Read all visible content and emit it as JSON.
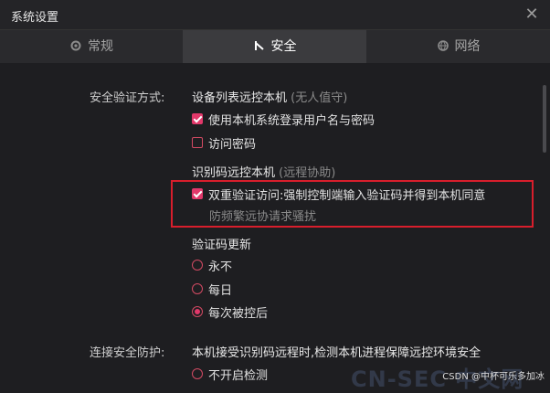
{
  "window": {
    "title": "系统设置"
  },
  "tabs": [
    {
      "label": "常规",
      "icon": "gear-icon",
      "active": false
    },
    {
      "label": "安全",
      "icon": "shield-icon",
      "active": true
    },
    {
      "label": "网络",
      "icon": "globe-icon",
      "active": false
    }
  ],
  "security": {
    "section_label": "安全验证方式:",
    "device_list": {
      "title": "设备列表远控本机",
      "note": "(无人值守)",
      "options": [
        {
          "label": "使用本机系统登录用户名与密码",
          "checked": true
        },
        {
          "label": "访问密码",
          "checked": false
        }
      ]
    },
    "id_code": {
      "title": "识别码远控本机",
      "note": "(远程协助)",
      "two_factor": {
        "label": "双重验证访问:强制控制端输入验证码并得到本机同意",
        "sub": "防频繁远协请求骚扰",
        "checked": true
      }
    },
    "code_update": {
      "title": "验证码更新",
      "options": [
        {
          "label": "永不",
          "selected": false
        },
        {
          "label": "每日",
          "selected": false
        },
        {
          "label": "每次被控后",
          "selected": true
        }
      ]
    }
  },
  "connection": {
    "section_label": "连接安全防护:",
    "description": "本机接受识别码远程时,检测本机进程保障远控环境安全",
    "options": [
      {
        "label": "不开启检测",
        "selected": false
      }
    ]
  },
  "watermark": {
    "csdn": "CSDN @中杯可乐多加冰",
    "cn": "CN-SEC 中文网"
  },
  "colors": {
    "accent": "#e2386a",
    "highlight_border": "#d81e2c",
    "background": "#1e1e21"
  }
}
